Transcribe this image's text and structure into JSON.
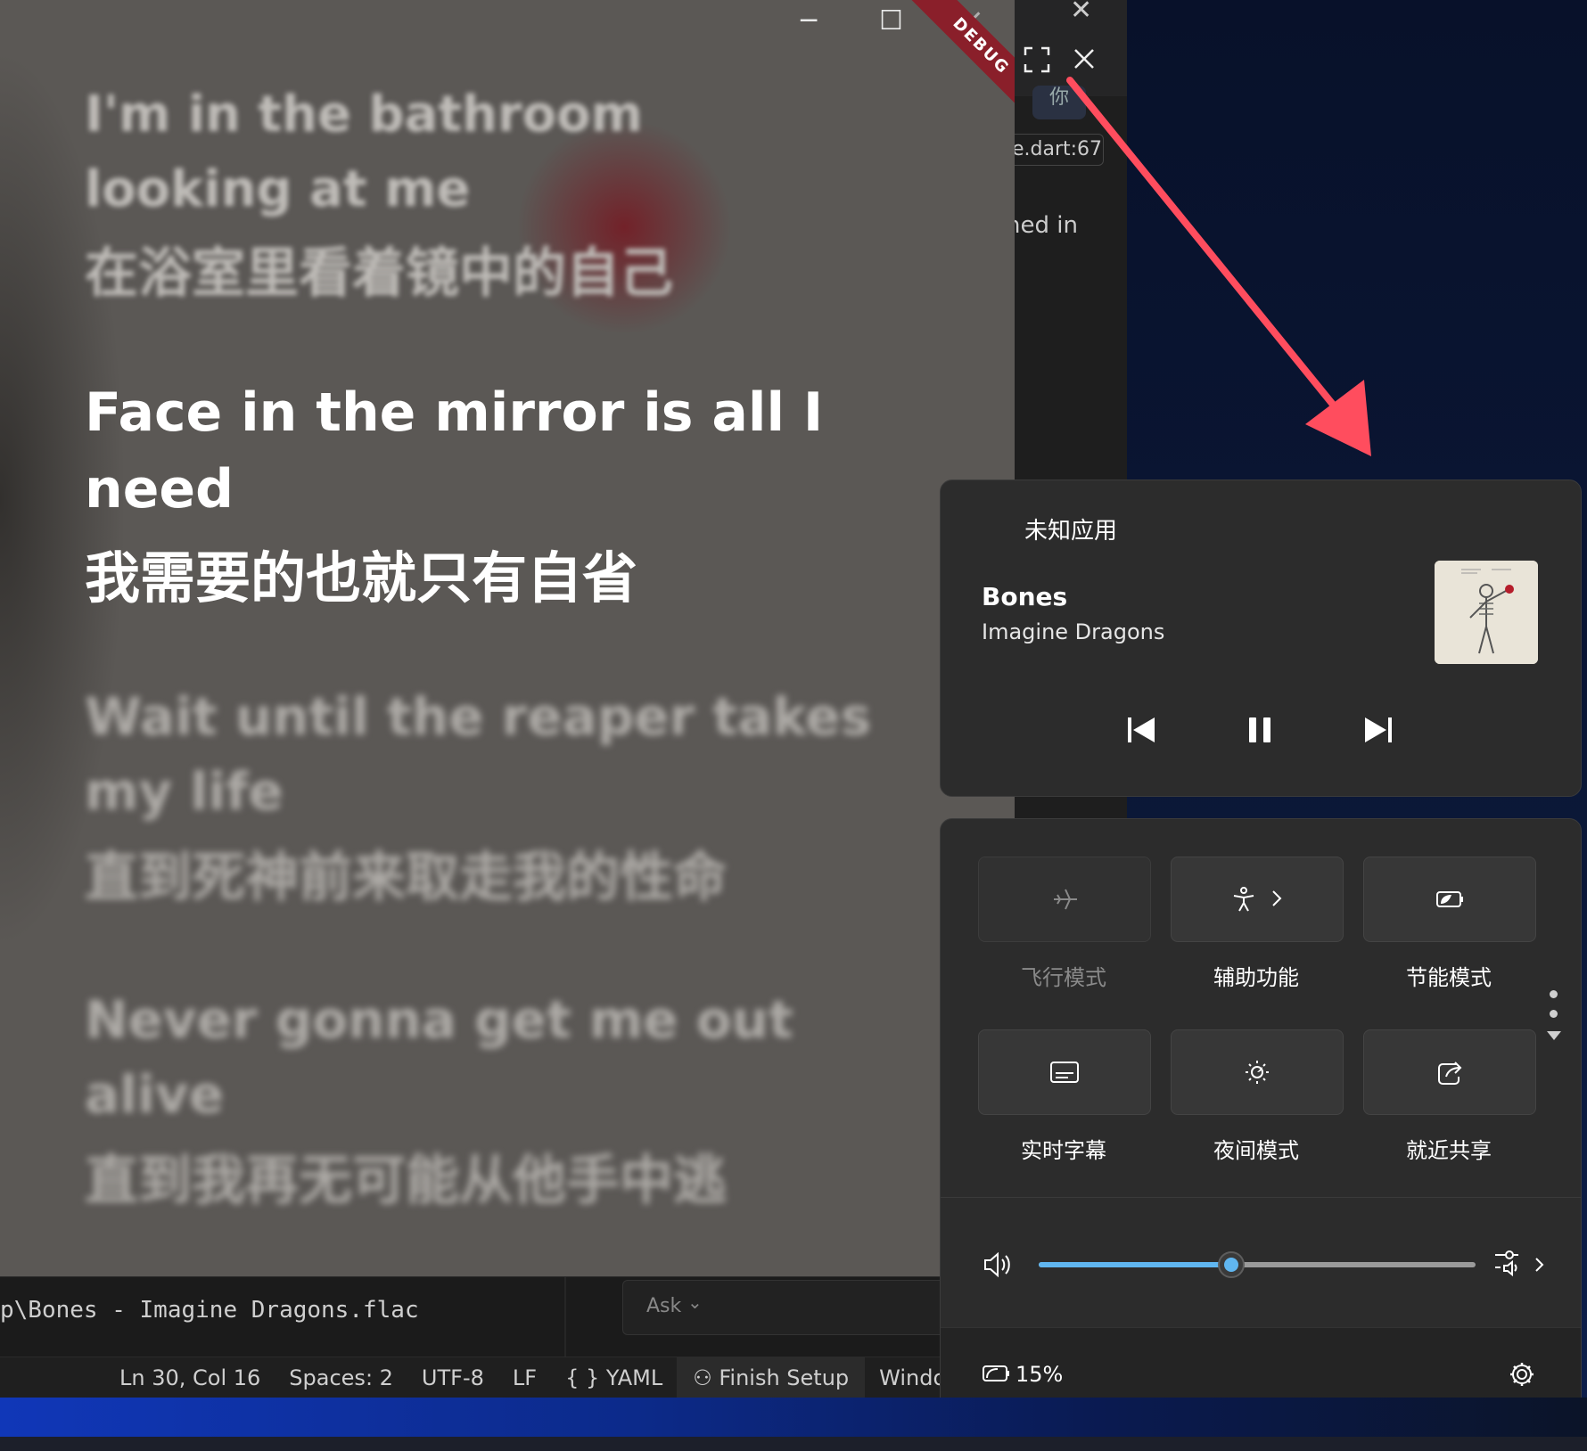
{
  "colors": {
    "accent": "#60b6f0",
    "debug_ribbon": "#8a1f2a",
    "arrow": "#ff4d5e"
  },
  "editor": {
    "file_badge": "你",
    "ref_chip": "e.dart:67",
    "ref_text": "ned in",
    "terminal_path": "p\\Bones - Imagine Dragons.flac",
    "ask_label": "Ask",
    "status": {
      "position": "Ln 30, Col 16",
      "spaces": "Spaces: 2",
      "encoding": "UTF-8",
      "eol": "LF",
      "language": "YAML",
      "finish_setup": "Finish Setup",
      "platform": "Windows (wi"
    }
  },
  "lyrics_app": {
    "debug_label": "DEBUG",
    "lines": {
      "prev_1": "I'm in the bathroom",
      "prev_2": "looking at me",
      "prev_3": "在浴室里看着镜中的自己",
      "cur_1": "Face in the mirror is all I",
      "cur_2": "need",
      "cur_3": "我需要的也就只有自省",
      "next_1": "Wait until the reaper takes",
      "next_2": "my life",
      "next_3": "直到死神前来取走我的性命",
      "next2_1": "Never gonna get me out",
      "next2_2": "alive",
      "next2_3": "直到我再无可能从他手中逃"
    }
  },
  "media": {
    "app_name": "未知应用",
    "title": "Bones",
    "artist": "Imagine Dragons"
  },
  "quick_settings": {
    "tiles": [
      {
        "label": "飞行模式",
        "icon": "airplane-icon",
        "enabled": false
      },
      {
        "label": "辅助功能",
        "icon": "accessibility-icon",
        "enabled": true
      },
      {
        "label": "节能模式",
        "icon": "energy-saver-icon",
        "enabled": true
      },
      {
        "label": "实时字幕",
        "icon": "live-captions-icon",
        "enabled": true
      },
      {
        "label": "夜间模式",
        "icon": "night-light-icon",
        "enabled": true
      },
      {
        "label": "就近共享",
        "icon": "nearby-share-icon",
        "enabled": true
      }
    ],
    "volume_level": 0.44,
    "battery_text": "15%"
  }
}
